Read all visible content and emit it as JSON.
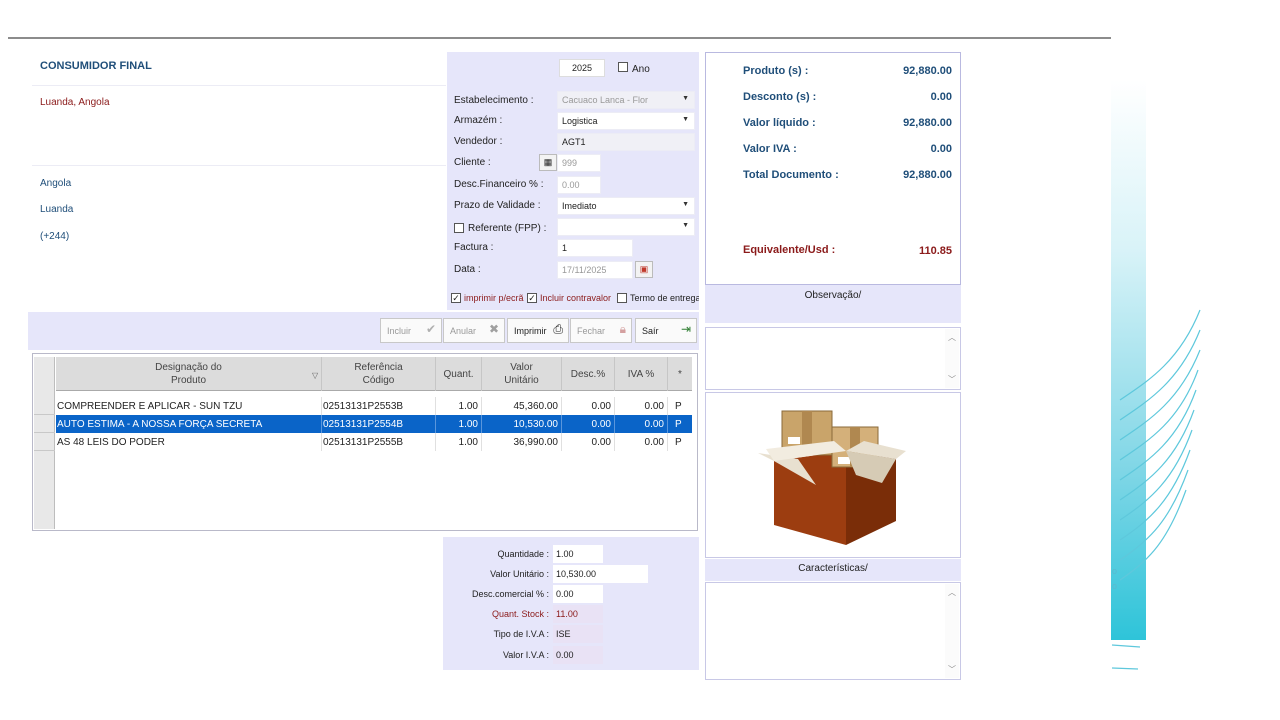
{
  "customer": {
    "name": "CONSUMIDOR FINAL",
    "address": "Luanda, Angola",
    "country": "Angola",
    "city": "Luanda",
    "phone_prefix": "(+244)"
  },
  "header": {
    "year": "2025",
    "year_check_label": "Ano",
    "establishment_label": "Estabelecimento :",
    "establishment_value": "Cacuaco Lanca - Flor",
    "warehouse_label": "Armazém :",
    "warehouse_value": "Logistica",
    "seller_label": "Vendedor :",
    "seller_value": "AGT1",
    "client_label": "Cliente :",
    "client_value": "999",
    "fin_discount_label": "Desc.Financeiro % :",
    "fin_discount_value": "0.00",
    "validity_label": "Prazo de Validade :",
    "validity_value": "Imediato",
    "referent_label": "Referente (FPP) :",
    "referent_value": "",
    "invoice_label": "Factura :",
    "invoice_value": "1",
    "date_label": "Data :",
    "date_value": "17/11/2025",
    "opt_print_screen": "imprimir p/ecrã",
    "opt_include_counter": "Incluir contravalor",
    "opt_delivery_term": "Termo de entrega"
  },
  "toolbar": {
    "include": "Incluir",
    "cancel": "Anular",
    "print": "Imprimir",
    "close": "Fechar",
    "exit": "Saír"
  },
  "grid": {
    "headers": {
      "designation": "Designação do\nProduto",
      "reference": "Referência\nCódigo",
      "quantity": "Quant.",
      "unit_value": "Valor\nUnitário",
      "discount": "Desc.%",
      "vat": "IVA %",
      "flag": "*"
    },
    "rows": [
      {
        "designation": "COMPREENDER E APLICAR - SUN TZU",
        "reference": "02513131P2553B",
        "quantity": "1.00",
        "unit_value": "45,360.00",
        "discount": "0.00",
        "vat": "0.00",
        "flag": "P"
      },
      {
        "designation": "AUTO ESTIMA - A NOSSA FORÇA SECRETA",
        "reference": "02513131P2554B",
        "quantity": "1.00",
        "unit_value": "10,530.00",
        "discount": "0.00",
        "vat": "0.00",
        "flag": "P"
      },
      {
        "designation": "AS 48 LEIS DO PODER",
        "reference": "02513131P2555B",
        "quantity": "1.00",
        "unit_value": "36,990.00",
        "discount": "0.00",
        "vat": "0.00",
        "flag": "P"
      }
    ]
  },
  "detail": {
    "quantity_label": "Quantidade :",
    "quantity_value": "1.00",
    "unit_value_label": "Valor Unitário :",
    "unit_value_value": "10,530.00",
    "comm_discount_label": "Desc.comercial % :",
    "comm_discount_value": "0.00",
    "stock_label": "Quant. Stock :",
    "stock_value": "11.00",
    "vat_type_label": "Tipo de I.V.A :",
    "vat_type_value": "ISE",
    "vat_value_label": "Valor I.V.A :",
    "vat_value_value": "0.00"
  },
  "totals": {
    "product_label": "Produto (s) :",
    "product_value": "92,880.00",
    "discount_label": "Desconto (s) :",
    "discount_value": "0.00",
    "net_label": "Valor líquido :",
    "net_value": "92,880.00",
    "vat_label": "Valor IVA :",
    "vat_value": "0.00",
    "total_label": "Total Documento :",
    "total_value": "92,880.00",
    "usd_label": "Equivalente/Usd :",
    "usd_value": "110.85"
  },
  "sections": {
    "observation": "Observação/",
    "characteristics": "Características/"
  },
  "colors": {
    "panel_bg": "#e6e6fa",
    "selection": "#0a64c8",
    "label_blue": "#1f4e79",
    "label_red": "#8b1a1a"
  }
}
